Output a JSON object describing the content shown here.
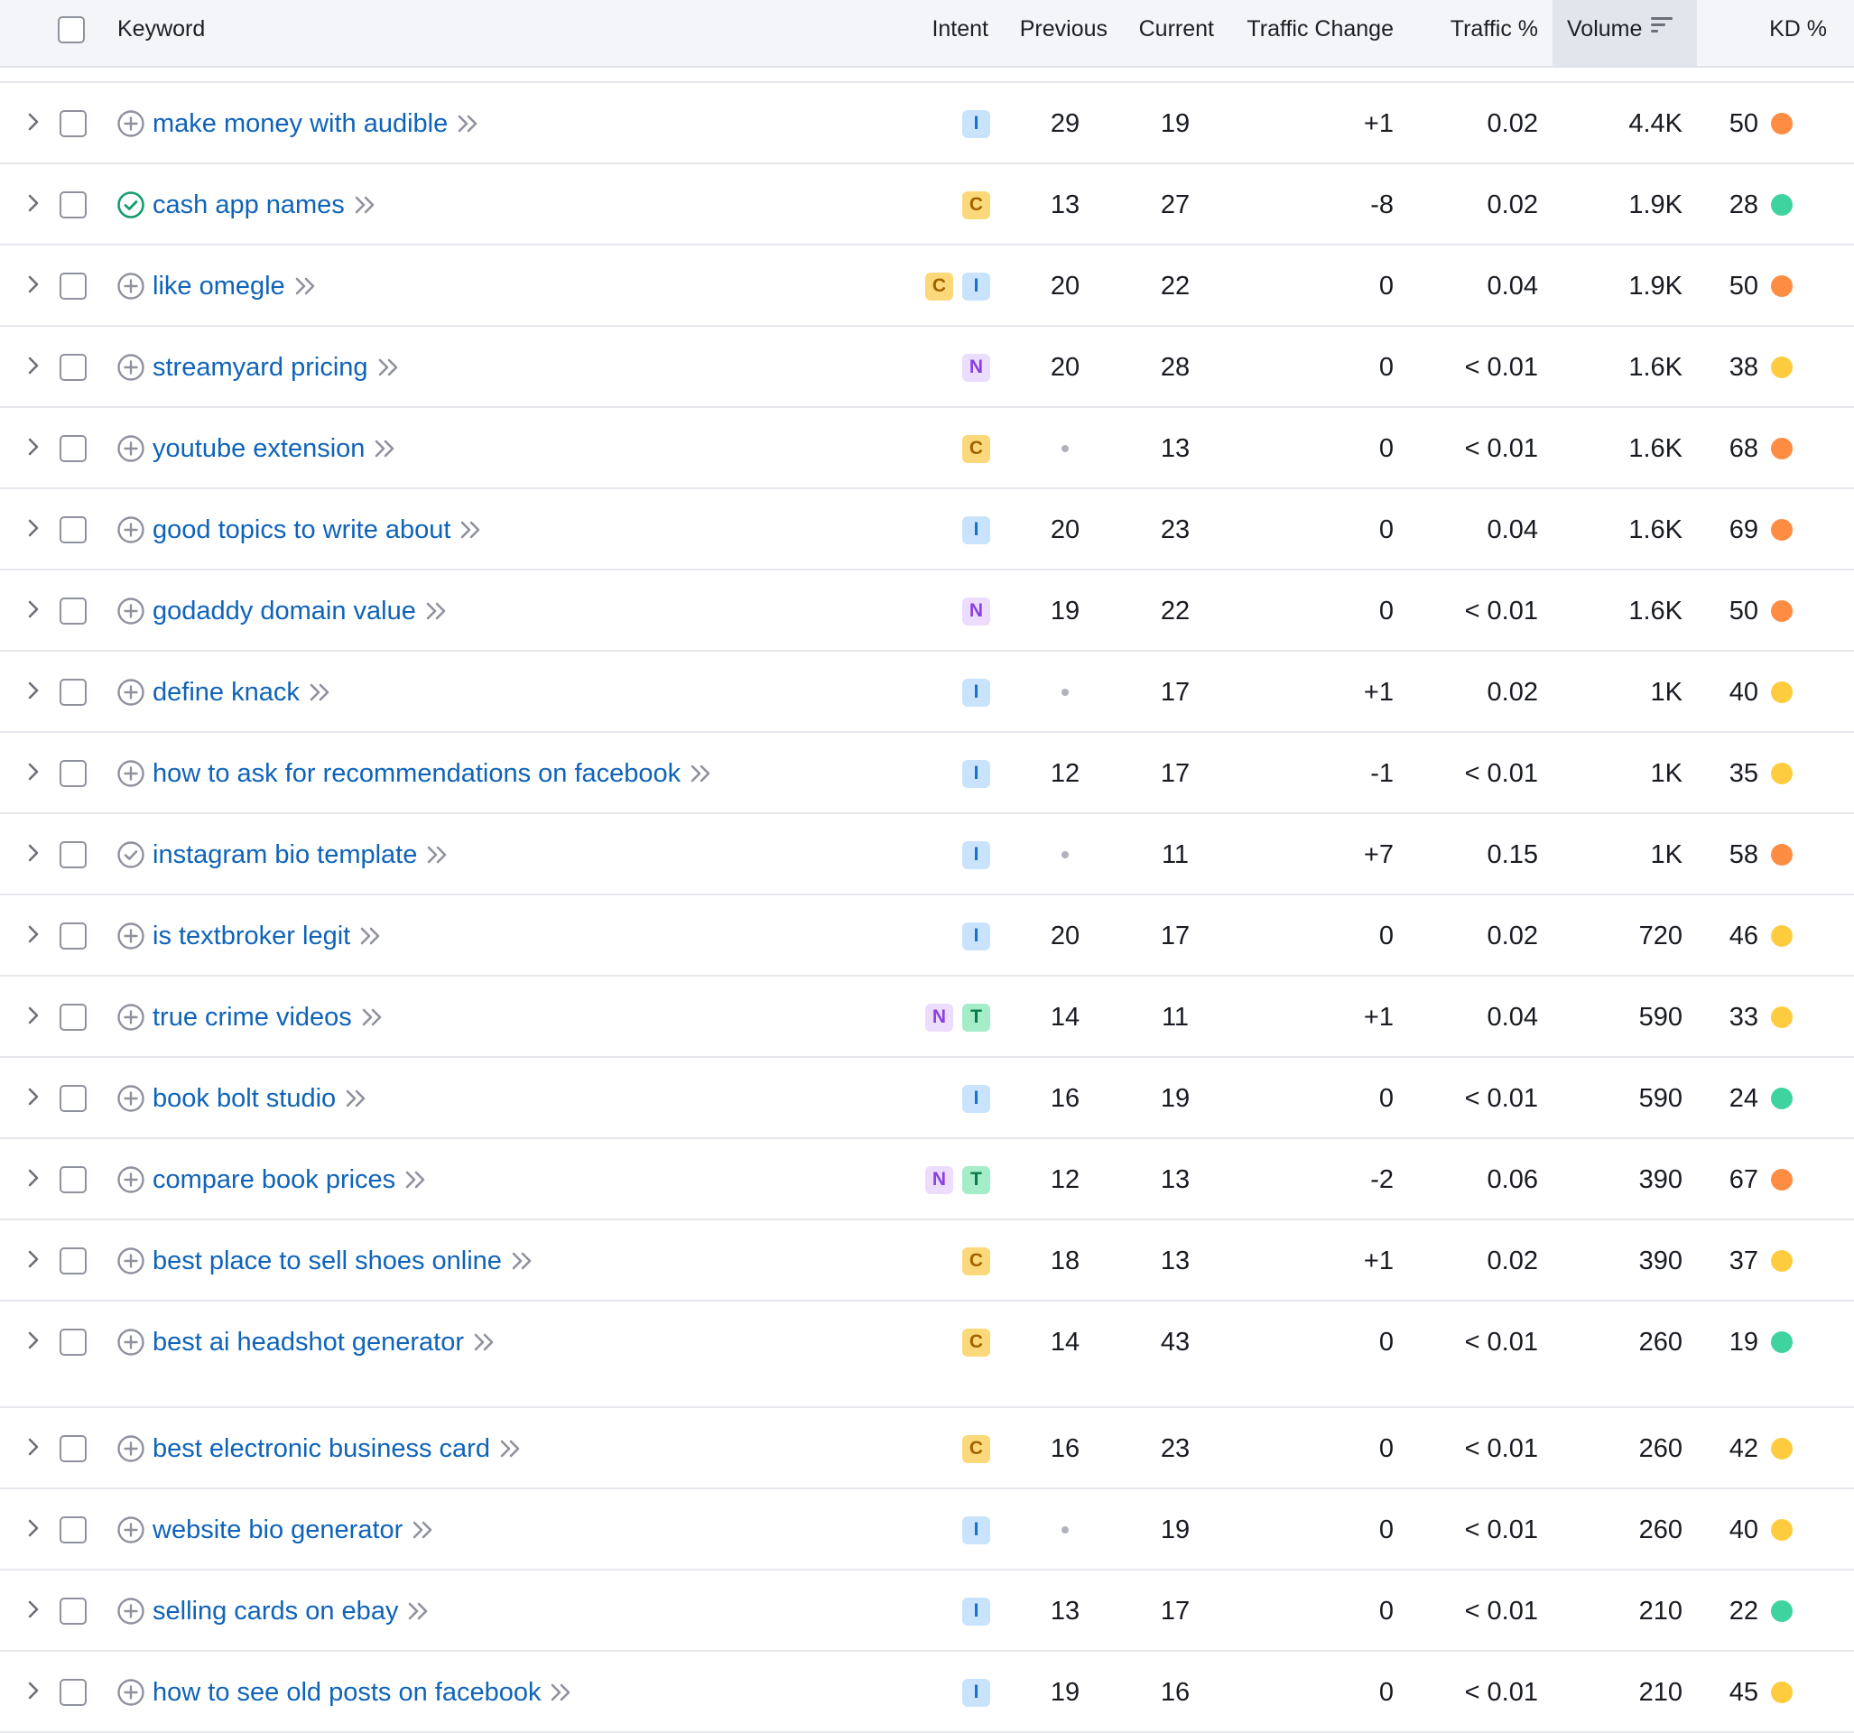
{
  "header": {
    "keyword": "Keyword",
    "intent": "Intent",
    "previous": "Previous",
    "current": "Current",
    "traffic_change": "Traffic Change",
    "traffic_pct": "Traffic %",
    "volume": "Volume",
    "kd": "KD %"
  },
  "kd_colors": {
    "orange": "#ff8c43",
    "yellow": "#ffcc40",
    "green": "#3fd3a0"
  },
  "rows": [
    {
      "keyword": "make money with audible",
      "status": "add",
      "intents": [
        "I"
      ],
      "previous": "29",
      "current": "19",
      "traffic_change": "+1",
      "traffic_pct": "0.02",
      "volume": "4.4K",
      "kd": "50",
      "kd_level": "orange"
    },
    {
      "keyword": "cash app names",
      "status": "added",
      "intents": [
        "C"
      ],
      "previous": "13",
      "current": "27",
      "traffic_change": "-8",
      "traffic_pct": "0.02",
      "volume": "1.9K",
      "kd": "28",
      "kd_level": "green"
    },
    {
      "keyword": "like omegle",
      "status": "add",
      "intents": [
        "C",
        "I"
      ],
      "previous": "20",
      "current": "22",
      "traffic_change": "0",
      "traffic_pct": "0.04",
      "volume": "1.9K",
      "kd": "50",
      "kd_level": "orange"
    },
    {
      "keyword": "streamyard pricing",
      "status": "add",
      "intents": [
        "N"
      ],
      "previous": "20",
      "current": "28",
      "traffic_change": "0",
      "traffic_pct": "< 0.01",
      "volume": "1.6K",
      "kd": "38",
      "kd_level": "yellow"
    },
    {
      "keyword": "youtube extension",
      "status": "add",
      "intents": [
        "C"
      ],
      "previous": "",
      "current": "13",
      "traffic_change": "0",
      "traffic_pct": "< 0.01",
      "volume": "1.6K",
      "kd": "68",
      "kd_level": "orange"
    },
    {
      "keyword": "good topics to write about",
      "status": "add",
      "intents": [
        "I"
      ],
      "previous": "20",
      "current": "23",
      "traffic_change": "0",
      "traffic_pct": "0.04",
      "volume": "1.6K",
      "kd": "69",
      "kd_level": "orange"
    },
    {
      "keyword": "godaddy domain value",
      "status": "add",
      "intents": [
        "N"
      ],
      "previous": "19",
      "current": "22",
      "traffic_change": "0",
      "traffic_pct": "< 0.01",
      "volume": "1.6K",
      "kd": "50",
      "kd_level": "orange"
    },
    {
      "keyword": "define knack",
      "status": "add",
      "intents": [
        "I"
      ],
      "previous": "",
      "current": "17",
      "traffic_change": "+1",
      "traffic_pct": "0.02",
      "volume": "1K",
      "kd": "40",
      "kd_level": "yellow"
    },
    {
      "keyword": "how to ask for recommendations on facebook",
      "status": "add",
      "intents": [
        "I"
      ],
      "previous": "12",
      "current": "17",
      "traffic_change": "-1",
      "traffic_pct": "< 0.01",
      "volume": "1K",
      "kd": "35",
      "kd_level": "yellow"
    },
    {
      "keyword": "instagram bio template",
      "status": "checked",
      "intents": [
        "I"
      ],
      "previous": "",
      "current": "11",
      "traffic_change": "+7",
      "traffic_pct": "0.15",
      "volume": "1K",
      "kd": "58",
      "kd_level": "orange"
    },
    {
      "keyword": "is textbroker legit",
      "status": "add",
      "intents": [
        "I"
      ],
      "previous": "20",
      "current": "17",
      "traffic_change": "0",
      "traffic_pct": "0.02",
      "volume": "720",
      "kd": "46",
      "kd_level": "yellow"
    },
    {
      "keyword": "true crime videos",
      "status": "add",
      "intents": [
        "N",
        "T"
      ],
      "previous": "14",
      "current": "11",
      "traffic_change": "+1",
      "traffic_pct": "0.04",
      "volume": "590",
      "kd": "33",
      "kd_level": "yellow"
    },
    {
      "keyword": "book bolt studio",
      "status": "add",
      "intents": [
        "I"
      ],
      "previous": "16",
      "current": "19",
      "traffic_change": "0",
      "traffic_pct": "< 0.01",
      "volume": "590",
      "kd": "24",
      "kd_level": "green"
    },
    {
      "keyword": "compare book prices",
      "status": "add",
      "intents": [
        "N",
        "T"
      ],
      "previous": "12",
      "current": "13",
      "traffic_change": "-2",
      "traffic_pct": "0.06",
      "volume": "390",
      "kd": "67",
      "kd_level": "orange"
    },
    {
      "keyword": "best place to sell shoes online",
      "status": "add",
      "intents": [
        "C"
      ],
      "previous": "18",
      "current": "13",
      "traffic_change": "+1",
      "traffic_pct": "0.02",
      "volume": "390",
      "kd": "37",
      "kd_level": "yellow"
    },
    {
      "keyword": "best ai headshot generator",
      "status": "add",
      "intents": [
        "C"
      ],
      "previous": "14",
      "current": "43",
      "traffic_change": "0",
      "traffic_pct": "< 0.01",
      "volume": "260",
      "kd": "19",
      "kd_level": "green"
    },
    {
      "keyword": "best electronic business card",
      "status": "add",
      "intents": [
        "C"
      ],
      "previous": "16",
      "current": "23",
      "traffic_change": "0",
      "traffic_pct": "< 0.01",
      "volume": "260",
      "kd": "42",
      "kd_level": "yellow"
    },
    {
      "keyword": "website bio generator",
      "status": "add",
      "intents": [
        "I"
      ],
      "previous": "",
      "current": "19",
      "traffic_change": "0",
      "traffic_pct": "< 0.01",
      "volume": "260",
      "kd": "40",
      "kd_level": "yellow"
    },
    {
      "keyword": "selling cards on ebay",
      "status": "add",
      "intents": [
        "I"
      ],
      "previous": "13",
      "current": "17",
      "traffic_change": "0",
      "traffic_pct": "< 0.01",
      "volume": "210",
      "kd": "22",
      "kd_level": "green"
    },
    {
      "keyword": "how to see old posts on facebook",
      "status": "add",
      "intents": [
        "I"
      ],
      "previous": "19",
      "current": "16",
      "traffic_change": "0",
      "traffic_pct": "< 0.01",
      "volume": "210",
      "kd": "45",
      "kd_level": "yellow"
    }
  ]
}
